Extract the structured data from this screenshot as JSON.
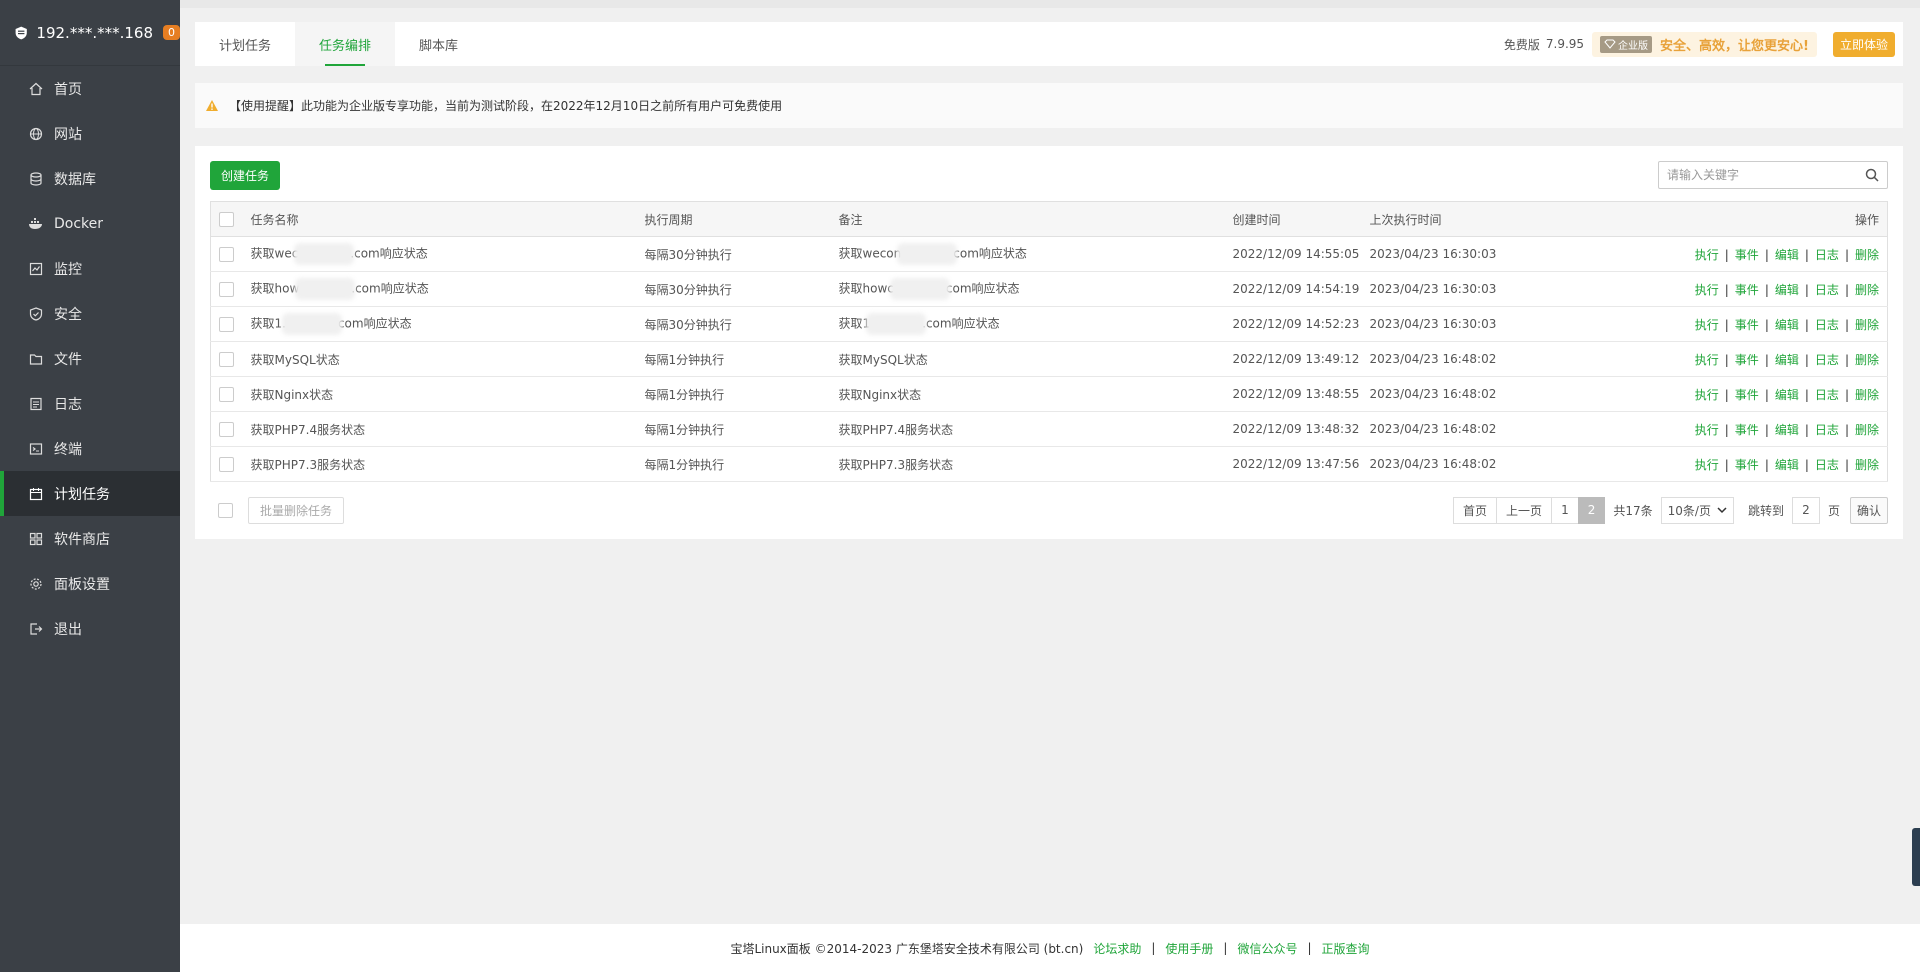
{
  "sidebar": {
    "ip": "192.***.***.168",
    "badge": "0",
    "items": [
      {
        "label": "首页",
        "icon": "home-icon"
      },
      {
        "label": "网站",
        "icon": "globe-icon"
      },
      {
        "label": "数据库",
        "icon": "database-icon"
      },
      {
        "label": "Docker",
        "icon": "docker-icon"
      },
      {
        "label": "监控",
        "icon": "monitor-icon"
      },
      {
        "label": "安全",
        "icon": "shield-icon"
      },
      {
        "label": "文件",
        "icon": "folder-icon"
      },
      {
        "label": "日志",
        "icon": "log-icon"
      },
      {
        "label": "终端",
        "icon": "terminal-icon"
      },
      {
        "label": "计划任务",
        "icon": "calendar-icon",
        "active": true
      },
      {
        "label": "软件商店",
        "icon": "apps-icon"
      },
      {
        "label": "面板设置",
        "icon": "gear-icon"
      },
      {
        "label": "退出",
        "icon": "logout-icon"
      }
    ]
  },
  "tabs": [
    "计划任务",
    "任务编排",
    "脚本库"
  ],
  "header": {
    "edition": "免费版",
    "version": "7.9.95",
    "enterprise_tag": "企业版",
    "promo": "安全、高效，让您更安心!",
    "try_button": "立即体验"
  },
  "notice": "【使用提醒】此功能为企业版专享功能，当前为测试阶段，在2022年12月10日之前所有用户可免费使用",
  "toolbar": {
    "create_button": "创建任务",
    "search_placeholder": "请输入关键字"
  },
  "table": {
    "headers": {
      "name": "任务名称",
      "cycle": "执行周期",
      "note": "备注",
      "created": "创建时间",
      "last": "上次执行时间",
      "ops": "操作"
    },
    "ops": [
      "执行",
      "事件",
      "编辑",
      "日志",
      "删除"
    ],
    "rows": [
      {
        "name_a": "获取wec",
        "name_b": ".com响应状态",
        "cycle": "每隔30分钟执行",
        "note_a": "获取wecon",
        "note_b": "com响应状态",
        "created": "2022/12/09 14:55:05",
        "last": "2023/04/23 16:30:03"
      },
      {
        "name_a": "获取how",
        "name_b": ".com响应状态",
        "cycle": "每隔30分钟执行",
        "note_a": "获取howc",
        "note_b": "com响应状态",
        "created": "2022/12/09 14:54:19",
        "last": "2023/04/23 16:30:03"
      },
      {
        "name_a": "获取1.",
        "name_b": "com响应状态",
        "cycle": "每隔30分钟执行",
        "note_a": "获取1",
        "note_b": ".com响应状态",
        "created": "2022/12/09 14:52:23",
        "last": "2023/04/23 16:30:03"
      },
      {
        "name_a": "获取MySQL状态",
        "name_b": "",
        "cycle": "每隔1分钟执行",
        "note_a": "获取MySQL状态",
        "note_b": "",
        "created": "2022/12/09 13:49:12",
        "last": "2023/04/23 16:48:02"
      },
      {
        "name_a": "获取Nginx状态",
        "name_b": "",
        "cycle": "每隔1分钟执行",
        "note_a": "获取Nginx状态",
        "note_b": "",
        "created": "2022/12/09 13:48:55",
        "last": "2023/04/23 16:48:02"
      },
      {
        "name_a": "获取PHP7.4服务状态",
        "name_b": "",
        "cycle": "每隔1分钟执行",
        "note_a": "获取PHP7.4服务状态",
        "note_b": "",
        "created": "2022/12/09 13:48:32",
        "last": "2023/04/23 16:48:02"
      },
      {
        "name_a": "获取PHP7.3服务状态",
        "name_b": "",
        "cycle": "每隔1分钟执行",
        "note_a": "获取PHP7.3服务状态",
        "note_b": "",
        "created": "2022/12/09 13:47:56",
        "last": "2023/04/23 16:48:02"
      }
    ]
  },
  "bottom": {
    "bulk_delete": "批量删除任务",
    "pager": {
      "first": "首页",
      "prev": "上一页",
      "pages": [
        "1",
        "2"
      ],
      "current": "2",
      "total": "共17条",
      "per_page": "10条/页",
      "goto": "跳转到",
      "goto_value": "2",
      "page_unit": "页",
      "confirm": "确认"
    }
  },
  "footer": {
    "copyright": "宝塔Linux面板 ©2014-2023 广东堡塔安全技术有限公司 (bt.cn)",
    "links": [
      "论坛求助",
      "使用手册",
      "微信公众号",
      "正版查询"
    ]
  },
  "colors": {
    "accent": "#20a53a",
    "sidebar_bg": "#3b4046",
    "warning": "#f0ad2e",
    "badge": "#e67e22"
  }
}
